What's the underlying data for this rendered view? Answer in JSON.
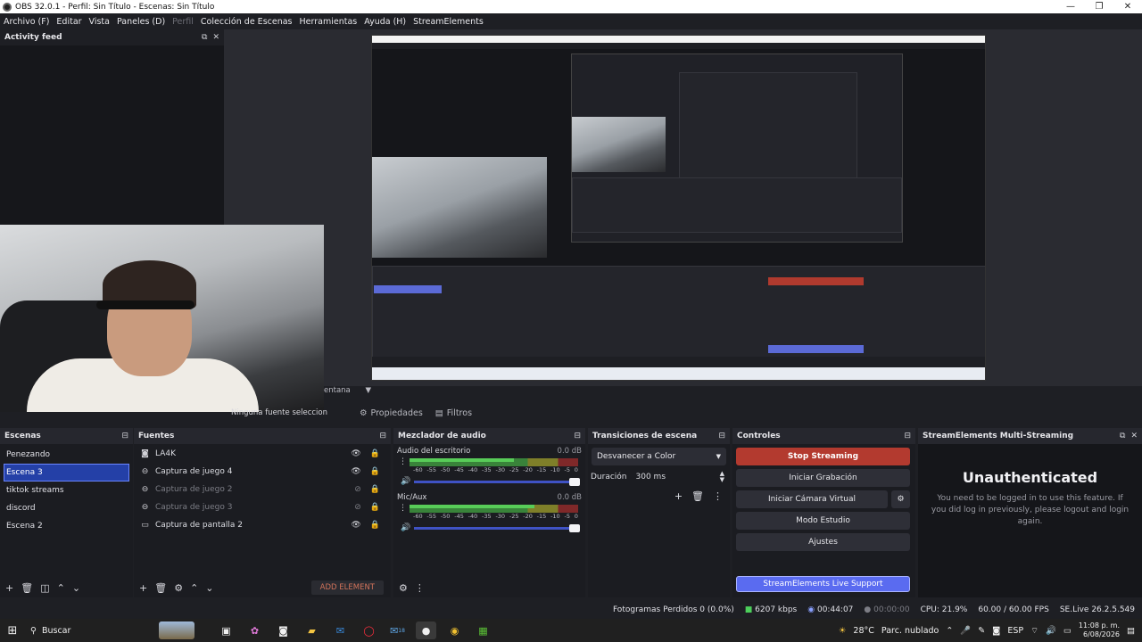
{
  "window": {
    "title": "OBS 32.0.1 - Perfil: Sin Título - Escenas: Sin Título",
    "controls": [
      "—",
      "❐",
      "✕"
    ]
  },
  "menu": {
    "items": [
      {
        "label": "Archivo (F)",
        "disabled": false
      },
      {
        "label": "Editar",
        "disabled": false
      },
      {
        "label": "Vista",
        "disabled": false
      },
      {
        "label": "Paneles (D)",
        "disabled": false
      },
      {
        "label": "Perfil",
        "disabled": true
      },
      {
        "label": "Colección de Escenas",
        "disabled": false
      },
      {
        "label": "Herramientas",
        "disabled": false
      },
      {
        "label": "Ayuda (H)",
        "disabled": false
      },
      {
        "label": "StreamElements",
        "disabled": false
      }
    ]
  },
  "activity_feed": {
    "title": "Activity feed"
  },
  "preview": {
    "no_source": "Ninguna fuente seleccionada",
    "window_label": "entana",
    "properties_tab": "Propiedades",
    "filters_tab": "Filtros"
  },
  "scenes": {
    "title": "Escenas",
    "items": [
      "Penezando",
      "Escena 3",
      "tiktok streams",
      "discord",
      "Escena 2"
    ],
    "selected_index": 1
  },
  "sources": {
    "title": "Fuentes",
    "items": [
      {
        "name": "LA4K",
        "icon": "camera-icon",
        "visible": true,
        "dim": false
      },
      {
        "name": "Captura de juego 4",
        "icon": "gamepad-icon",
        "visible": true,
        "dim": false
      },
      {
        "name": "Captura de juego 2",
        "icon": "gamepad-icon",
        "visible": false,
        "dim": true
      },
      {
        "name": "Captura de juego 3",
        "icon": "gamepad-icon",
        "visible": false,
        "dim": true
      },
      {
        "name": "Captura de pantalla 2",
        "icon": "monitor-icon",
        "visible": true,
        "dim": false
      }
    ],
    "add_element": "ADD ELEMENT"
  },
  "mixer": {
    "title": "Mezclador de audio",
    "channels": [
      {
        "name": "Audio del escritorio",
        "db": "0.0 dB",
        "level": 0.62
      },
      {
        "name": "Mic/Aux",
        "db": "0.0 dB",
        "level": 0.74
      }
    ],
    "ticks": [
      "-60",
      "-55",
      "-50",
      "-45",
      "-40",
      "-35",
      "-30",
      "-25",
      "-20",
      "-15",
      "-10",
      "-5",
      "0"
    ]
  },
  "transitions": {
    "title": "Transiciones de escena",
    "selected": "Desvanecer a Color",
    "duration_label": "Duración",
    "duration_value": "300 ms"
  },
  "controls": {
    "title": "Controles",
    "stop_streaming": "Stop Streaming",
    "start_recording": "Iniciar Grabación",
    "virtual_cam": "Iniciar Cámara Virtual",
    "studio_mode": "Modo Estudio",
    "settings": "Ajustes",
    "live_support": "StreamElements Live Support"
  },
  "multistreaming": {
    "title": "StreamElements Multi-Streaming",
    "heading": "Unauthenticated",
    "message": "You need to be logged in to use this feature. If you did log in previously, please logout and login again."
  },
  "status": {
    "dropped": "Fotogramas Perdidos 0 (0.0%)",
    "bitrate": "6207 kbps",
    "stream_time": "00:44:07",
    "rec_time": "00:00:00",
    "cpu": "CPU: 21.9%",
    "fps": "60.00 / 60.00 FPS",
    "version": "SE.Live 26.2.5.549"
  },
  "taskbar": {
    "search": "Buscar",
    "weather_temp": "28°C",
    "weather_text": "Parc. nublado",
    "lang": "ESP",
    "time": "11:08 p. m.",
    "date": "6/08/2026",
    "mail_badge": "18"
  },
  "colors": {
    "accent_blue": "#2440a7",
    "stop_red": "#b33a2f",
    "support_blue": "#5a6bf0"
  }
}
